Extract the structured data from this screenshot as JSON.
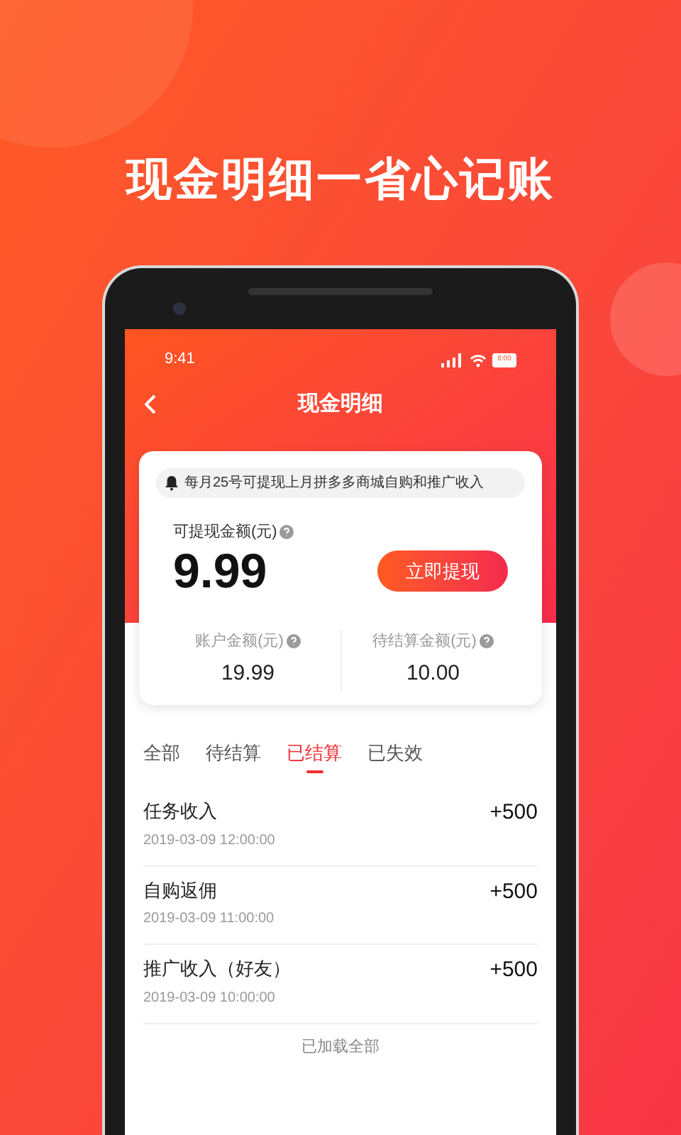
{
  "headline": "现金明细一省心记账",
  "status_bar": {
    "time": "9:41",
    "battery_text": "8:00"
  },
  "nav": {
    "title": "现金明细"
  },
  "card": {
    "notice": "每月25号可提现上月拼多多商城自购和推广收入",
    "withdrawable_label": "可提现金额(元)",
    "withdrawable_amount": "9.99",
    "withdraw_button": "立即提现",
    "stats": [
      {
        "label": "账户金额(元)",
        "value": "19.99"
      },
      {
        "label": "待结算金额(元)",
        "value": "10.00"
      }
    ]
  },
  "tabs": [
    {
      "label": "全部",
      "selected": false
    },
    {
      "label": "待结算",
      "selected": false
    },
    {
      "label": "已结算",
      "selected": true
    },
    {
      "label": "已失效",
      "selected": false
    }
  ],
  "records": [
    {
      "title": "任务收入",
      "time": "2019-03-09 12:00:00",
      "amount": "+500"
    },
    {
      "title": "自购返佣",
      "time": "2019-03-09 11:00:00",
      "amount": "+500"
    },
    {
      "title": "推广收入（好友）",
      "time": "2019-03-09 10:00:00",
      "amount": "+500"
    }
  ],
  "footer": "已加载全部"
}
